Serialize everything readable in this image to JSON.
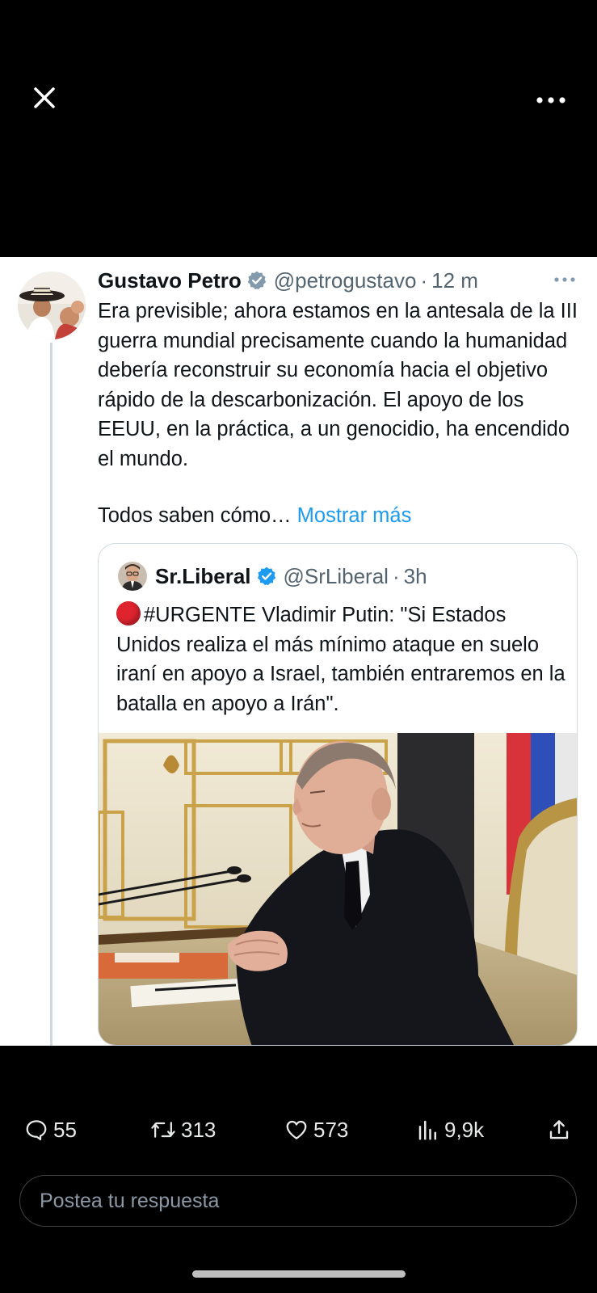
{
  "top_bar": {
    "close_icon": "close-icon",
    "more_icon": "more-horizontal-icon"
  },
  "tweet": {
    "author_name": "Gustavo Petro",
    "handle": "@petrogustavo",
    "separator": "·",
    "time": "12 m",
    "paragraph_1": "Era previsible; ahora estamos en la antesala de la III guerra mundial precisamente cuando la humanidad debería reconstruir su economía hacia el objetivo rápido de la descarbonización. El apoyo de los EEUU, en la práctica, a un genocidio, ha encendido el mundo.",
    "paragraph_2": "Todos saben cómo…",
    "show_more": "Mostrar más"
  },
  "quoted": {
    "author_name": "Sr.Liberal",
    "handle": "@SrLiberal",
    "separator": "·",
    "time": "3h",
    "text": "#URGENTE Vladimir Putin:  \"Si Estados Unidos realiza el más mínimo ataque en suelo iraní en apoyo a Israel, también entraremos en la batalla en apoyo a Irán\"."
  },
  "actions": {
    "replies": "55",
    "retweets": "313",
    "likes": "573",
    "views": "9,9k"
  },
  "reply": {
    "placeholder": "Postea tu respuesta"
  },
  "colors": {
    "accent": "#1d9bf0",
    "background": "#000000",
    "card": "#ffffff",
    "muted": "#536471"
  }
}
